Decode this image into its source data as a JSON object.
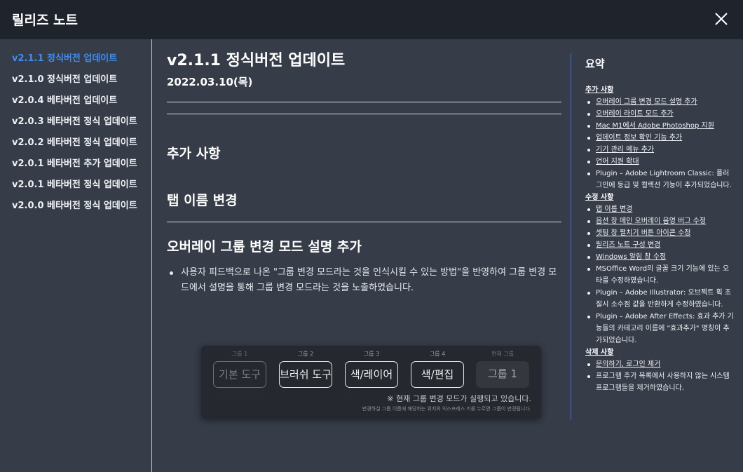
{
  "window": {
    "title": "릴리즈 노트"
  },
  "sidebar": {
    "items": [
      {
        "label": "v2.1.1 정식버전 업데이트"
      },
      {
        "label": "v2.1.0 정식버전 업데이트"
      },
      {
        "label": "v2.0.4 베타버전 업데이트"
      },
      {
        "label": "v2.0.3 베타버전 정식 업데이트"
      },
      {
        "label": "v2.0.2 베타버전 정식 업데이트"
      },
      {
        "label": "v2.0.1 베타버전 추가 업데이트"
      },
      {
        "label": "v2.0.1 베타버전 정식 업데이트"
      },
      {
        "label": "v2.0.0 베타버전 정식 업데이트"
      }
    ]
  },
  "main": {
    "title": "v2.1.1 정식버전 업데이트",
    "date": "2022.03.10(목)",
    "sections": [
      {
        "heading": "추가 사항"
      },
      {
        "heading": "탭 이름 변경"
      },
      {
        "heading": "오버레이 그룹 변경 모드 설명 추가"
      }
    ],
    "bullet": "사용자 피드백으로 나온 \"그룹 변경 모드라는 것을 인식시킬 수 있는 방법\"을 반영하여 그룹 변경 모드에서 설명을 통해 그룹 변경 모드라는 것을 노출하였습니다.",
    "screenshot": {
      "groups": [
        {
          "label": "그룹 1",
          "button": "기본 도구"
        },
        {
          "label": "그룹 2",
          "button": "브러쉬 도구"
        },
        {
          "label": "그룹 3",
          "button": "색/레이어"
        },
        {
          "label": "그룹 4",
          "button": "색/편집"
        },
        {
          "label": "현재 그룹",
          "button": "그룹 1"
        }
      ],
      "note": "※ 현재 그룹 변경 모드가 실행되고 있습니다.",
      "footnote": "변경하실 그룹 이름에 해당하는 위치의 익스프레스 키를 누르면 그룹이 변경됩니다."
    }
  },
  "summary": {
    "title": "요약",
    "added_heading": "추가 사항",
    "added": [
      "오버레이 그룹 변경 모드 설명 추가",
      "오버레이 라이트 모드 추가",
      "Mac M1에서 Adobe Photoshop 지원",
      "업데이트 정보 확인 기능 추가",
      "기기 관리 메뉴 추가",
      "언어 지원 확대",
      "Plugin – Adobe Lightroom Classic: 플러그인에 등급 및 컬렉션 기능이 추가되었습니다."
    ],
    "fixed_heading": "수정 사항",
    "fixed": [
      "탭 이름 변경",
      "옵션 창 메인 오버레이 음영 버그 수정",
      "셋팅 창 펼치기 버튼 아이콘 수정",
      "릴리즈 노트 구성 변경",
      "Windows 알림 창 수정",
      "MSOffice Word의 글꼴 크기 기능에 있는 오타를 수정하였습니다.",
      "Plugin – Adobe Illustrator: 오브젝트 획 조절시 소수점 값을 반환하게 수정하였습니다.",
      "Plugin – Adobe After Effects: 효과 추가 기능들의 카테고리 이름에 \"효과추가\" 명칭이 추가되었습니다."
    ],
    "removed_heading": "삭제 사항",
    "removed": [
      "문의하기, 로그인 제거",
      "프로그램 추가 목록에서 사용하지 않는 시스템 프로그램들을 제거하였습니다."
    ]
  }
}
